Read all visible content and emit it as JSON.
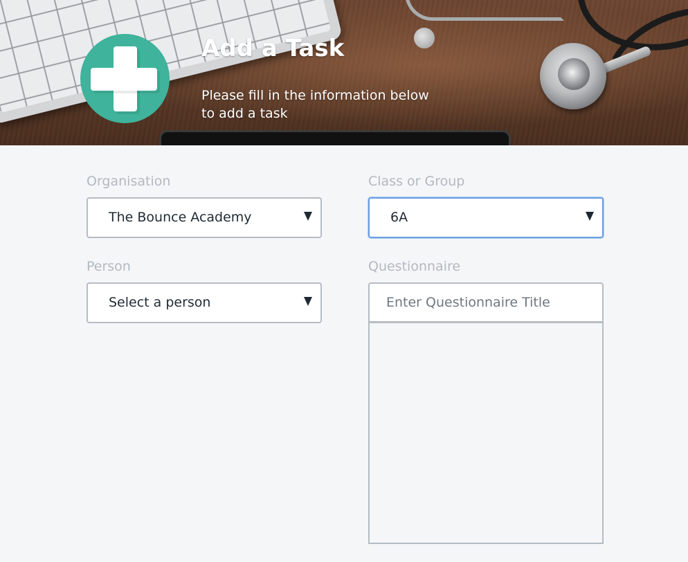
{
  "header": {
    "title": "Add a Task",
    "subtitle_line1": "Please fill in the information below",
    "subtitle_line2": "to add a task"
  },
  "form": {
    "organisation": {
      "label": "Organisation",
      "selected": "The Bounce Academy"
    },
    "class_or_group": {
      "label": "Class or Group",
      "selected": "6A"
    },
    "person": {
      "label": "Person",
      "selected": "Select a person"
    },
    "questionnaire": {
      "label": "Questionnaire",
      "placeholder": "Enter Questionnaire Title",
      "value": ""
    }
  },
  "colors": {
    "accent_teal": "#3fb39b",
    "label_gray": "#b3b9c0",
    "focus_blue": "#6c9ee3",
    "page_background": "#f4f6f8"
  },
  "icons": {
    "logo": "medical-cross-icon",
    "dropdown": "dropdown-arrow-icon"
  }
}
